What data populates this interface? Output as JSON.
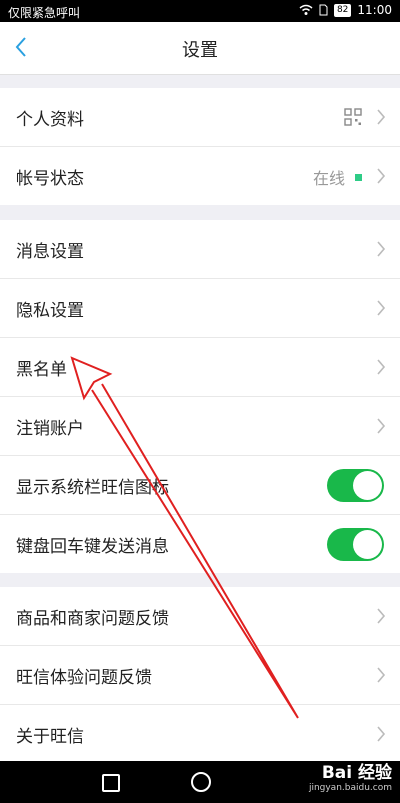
{
  "status_bar": {
    "carrier": "仅限紧急呼叫",
    "battery": "82",
    "time": "11:00"
  },
  "header": {
    "title": "设置"
  },
  "groups": [
    {
      "items": [
        {
          "label": "个人资料"
        },
        {
          "label": "帐号状态",
          "status": "在线"
        }
      ]
    },
    {
      "items": [
        {
          "label": "消息设置"
        },
        {
          "label": "隐私设置"
        },
        {
          "label": "黑名单"
        },
        {
          "label": "注销账户"
        },
        {
          "label": "显示系统栏旺信图标",
          "toggle": true
        },
        {
          "label": "键盘回车键发送消息",
          "toggle": true
        }
      ]
    },
    {
      "items": [
        {
          "label": "商品和商家问题反馈"
        },
        {
          "label": "旺信体验问题反馈"
        },
        {
          "label": "关于旺信"
        }
      ]
    }
  ],
  "colors": {
    "toggle_on": "#19b84a",
    "online_dot": "#2ecc87",
    "back_accent": "#2aa0e0",
    "annotation_arrow": "#e02020"
  },
  "watermark": {
    "brand": "Bai 经验",
    "url": "jingyan.baidu.com"
  }
}
